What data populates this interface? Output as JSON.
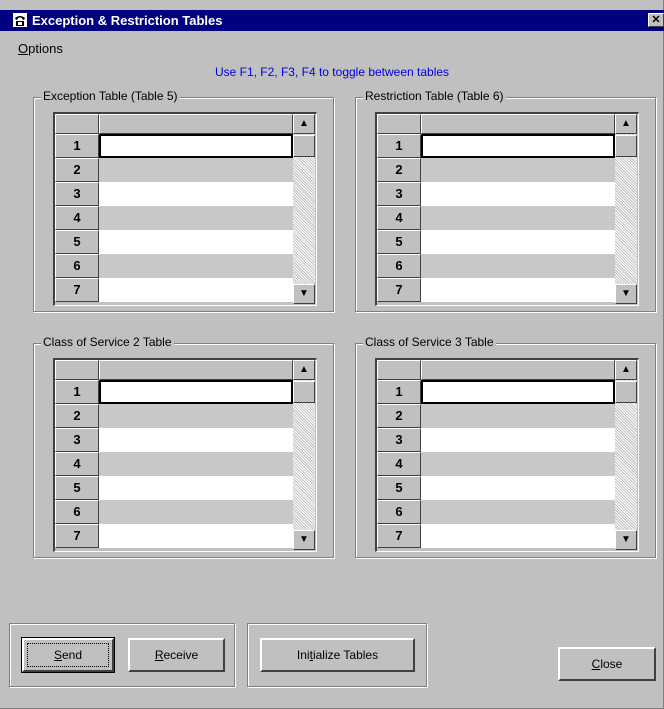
{
  "window": {
    "title": "Exception & Restriction Tables",
    "close_glyph": "✕",
    "icon": "phone-icon"
  },
  "menu": {
    "options_label": "Options",
    "options_mnemonic": "O",
    "options_rest": "ptions"
  },
  "hint": "Use F1, F2, F3, F4 to toggle between tables",
  "tables": [
    {
      "title": "Exception Table (Table 5)",
      "rows": [
        "1",
        "2",
        "3",
        "4",
        "5",
        "6",
        "7"
      ]
    },
    {
      "title": "Restriction Table (Table 6)",
      "rows": [
        "1",
        "2",
        "3",
        "4",
        "5",
        "6",
        "7"
      ]
    },
    {
      "title": "Class of Service 2 Table",
      "rows": [
        "1",
        "2",
        "3",
        "4",
        "5",
        "6",
        "7"
      ]
    },
    {
      "title": "Class of Service 3 Table",
      "rows": [
        "1",
        "2",
        "3",
        "4",
        "5",
        "6",
        "7"
      ]
    }
  ],
  "scrollbar": {
    "up_glyph": "▲",
    "down_glyph": "▼"
  },
  "buttons": {
    "send": {
      "label": "Send",
      "mnemonic": "S",
      "rest": "end"
    },
    "receive": {
      "label": "Receive",
      "mnemonic": "R",
      "rest": "eceive"
    },
    "initialize": {
      "label": "Initialize Tables",
      "pre": "Ini",
      "mnemonic": "t",
      "rest": "ialize Tables"
    },
    "close": {
      "label": "Close",
      "mnemonic": "C",
      "rest": "lose"
    }
  },
  "colors": {
    "title_bar": "#000080",
    "face": "#c0c0c0",
    "hint_text": "#0000e0"
  }
}
